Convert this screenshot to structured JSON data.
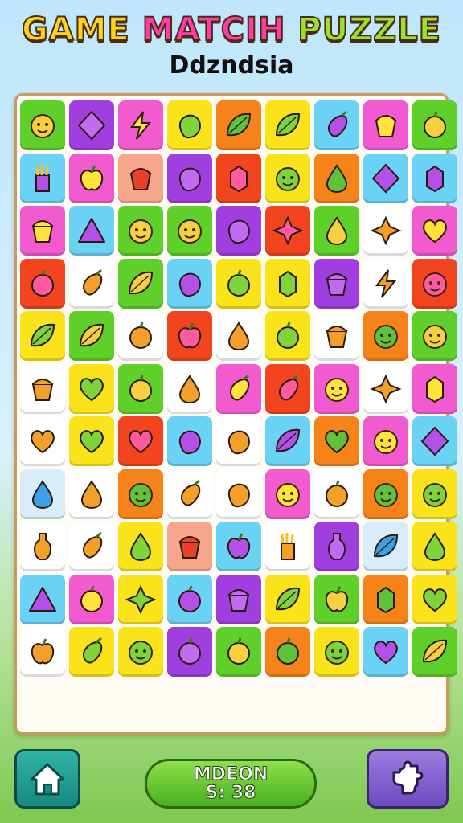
{
  "header": {
    "title_parts": [
      "GAME",
      "MATCIH",
      "PUZZLE"
    ],
    "subtitle": "Ddzndsia"
  },
  "footer": {
    "score_label": "MDEON",
    "score_value": "S: 38"
  },
  "colors": {
    "G": "#5fd02a",
    "P": "#a03ee0",
    "K": "#f25ad0",
    "Y": "#fbe31b",
    "O": "#f5831a",
    "C": "#6ad2f5",
    "R": "#f2441e",
    "W": "#ffffff",
    "B": "#d8edf9",
    "S": "#f6a78b"
  },
  "board": {
    "rows": [
      [
        [
          "G",
          "face"
        ],
        [
          "P",
          "diamond"
        ],
        [
          "K",
          "bolt"
        ],
        [
          "Y",
          "blob"
        ],
        [
          "O",
          "leaf"
        ],
        [
          "Y",
          "leaf"
        ],
        [
          "C",
          "eggplant"
        ],
        [
          "K",
          "cup"
        ],
        [
          "G",
          "fruit"
        ]
      ],
      [
        [
          "C",
          "fries"
        ],
        [
          "K",
          "apple"
        ],
        [
          "S",
          "cup"
        ],
        [
          "P",
          "blob"
        ],
        [
          "R",
          "gem"
        ],
        [
          "Y",
          "face"
        ],
        [
          "O",
          "drop"
        ],
        [
          "C",
          "diamond"
        ],
        [
          "C",
          "gem"
        ]
      ],
      [
        [
          "K",
          "cup"
        ],
        [
          "C",
          "triangle"
        ],
        [
          "G",
          "face"
        ],
        [
          "G",
          "face"
        ],
        [
          "P",
          "blob"
        ],
        [
          "R",
          "star"
        ],
        [
          "G",
          "drop"
        ],
        [
          "W",
          "star"
        ],
        [
          "K",
          "heart"
        ]
      ],
      [
        [
          "R",
          "fruit"
        ],
        [
          "W",
          "eggplant"
        ],
        [
          "G",
          "leaf"
        ],
        [
          "C",
          "blob"
        ],
        [
          "Y",
          "fruit"
        ],
        [
          "Y",
          "gem"
        ],
        [
          "P",
          "cup"
        ],
        [
          "W",
          "bolt"
        ],
        [
          "R",
          "face"
        ]
      ],
      [
        [
          "Y",
          "leaf"
        ],
        [
          "G",
          "leaf"
        ],
        [
          "W",
          "fruit"
        ],
        [
          "R",
          "apple"
        ],
        [
          "W",
          "drop"
        ],
        [
          "Y",
          "fruit"
        ],
        [
          "W",
          "cup"
        ],
        [
          "O",
          "face"
        ],
        [
          "G",
          "face"
        ]
      ],
      [
        [
          "W",
          "cup"
        ],
        [
          "Y",
          "heart"
        ],
        [
          "G",
          "fruit"
        ],
        [
          "W",
          "drop"
        ],
        [
          "K",
          "eggplant"
        ],
        [
          "R",
          "eggplant"
        ],
        [
          "K",
          "face"
        ],
        [
          "W",
          "star"
        ],
        [
          "K",
          "gem"
        ]
      ],
      [
        [
          "W",
          "heart"
        ],
        [
          "Y",
          "heart"
        ],
        [
          "R",
          "heart"
        ],
        [
          "C",
          "blob"
        ],
        [
          "W",
          "blob"
        ],
        [
          "C",
          "leaf"
        ],
        [
          "O",
          "heart"
        ],
        [
          "K",
          "face"
        ],
        [
          "C",
          "diamond"
        ]
      ],
      [
        [
          "B",
          "drop"
        ],
        [
          "W",
          "drop"
        ],
        [
          "O",
          "face"
        ],
        [
          "W",
          "eggplant"
        ],
        [
          "W",
          "blob"
        ],
        [
          "K",
          "face"
        ],
        [
          "W",
          "fruit"
        ],
        [
          "O",
          "face"
        ],
        [
          "Y",
          "face"
        ]
      ],
      [
        [
          "W",
          "vase"
        ],
        [
          "W",
          "eggplant"
        ],
        [
          "Y",
          "drop"
        ],
        [
          "S",
          "cup"
        ],
        [
          "C",
          "apple"
        ],
        [
          "W",
          "fries"
        ],
        [
          "P",
          "vase"
        ],
        [
          "B",
          "leaf"
        ],
        [
          "Y",
          "drop"
        ]
      ],
      [
        [
          "C",
          "triangle"
        ],
        [
          "K",
          "fruit"
        ],
        [
          "Y",
          "star"
        ],
        [
          "C",
          "fruit"
        ],
        [
          "P",
          "cup"
        ],
        [
          "Y",
          "leaf"
        ],
        [
          "G",
          "apple"
        ],
        [
          "O",
          "gem"
        ],
        [
          "Y",
          "heart"
        ]
      ],
      [
        [
          "W",
          "apple"
        ],
        [
          "Y",
          "eggplant"
        ],
        [
          "Y",
          "face"
        ],
        [
          "P",
          "fruit"
        ],
        [
          "G",
          "fruit"
        ],
        [
          "O",
          "fruit"
        ],
        [
          "Y",
          "face"
        ],
        [
          "C",
          "heart"
        ],
        [
          "G",
          "leaf"
        ]
      ]
    ]
  }
}
